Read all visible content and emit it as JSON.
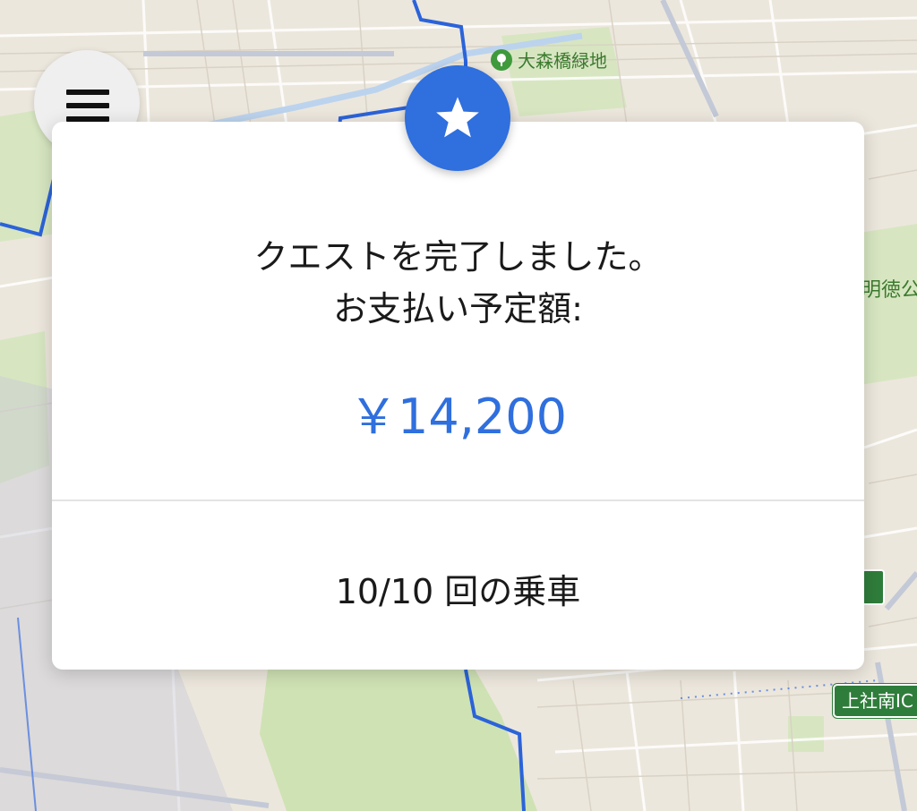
{
  "map": {
    "park_label": "大森橋緑地",
    "right_label": "明徳公",
    "ic_sign": "上社南IC",
    "park_icon": "tree-icon"
  },
  "menu": {
    "icon": "hamburger-menu-icon"
  },
  "quest_card": {
    "badge_icon": "star-icon",
    "title_line1": "クエストを完了しました。",
    "title_line2": "お支払い予定額:",
    "amount": "￥14,200",
    "rides": "10/10 回の乗車"
  },
  "colors": {
    "accent": "#2f6fde",
    "route": "#2b63d9",
    "park": "#cfe2b4"
  }
}
